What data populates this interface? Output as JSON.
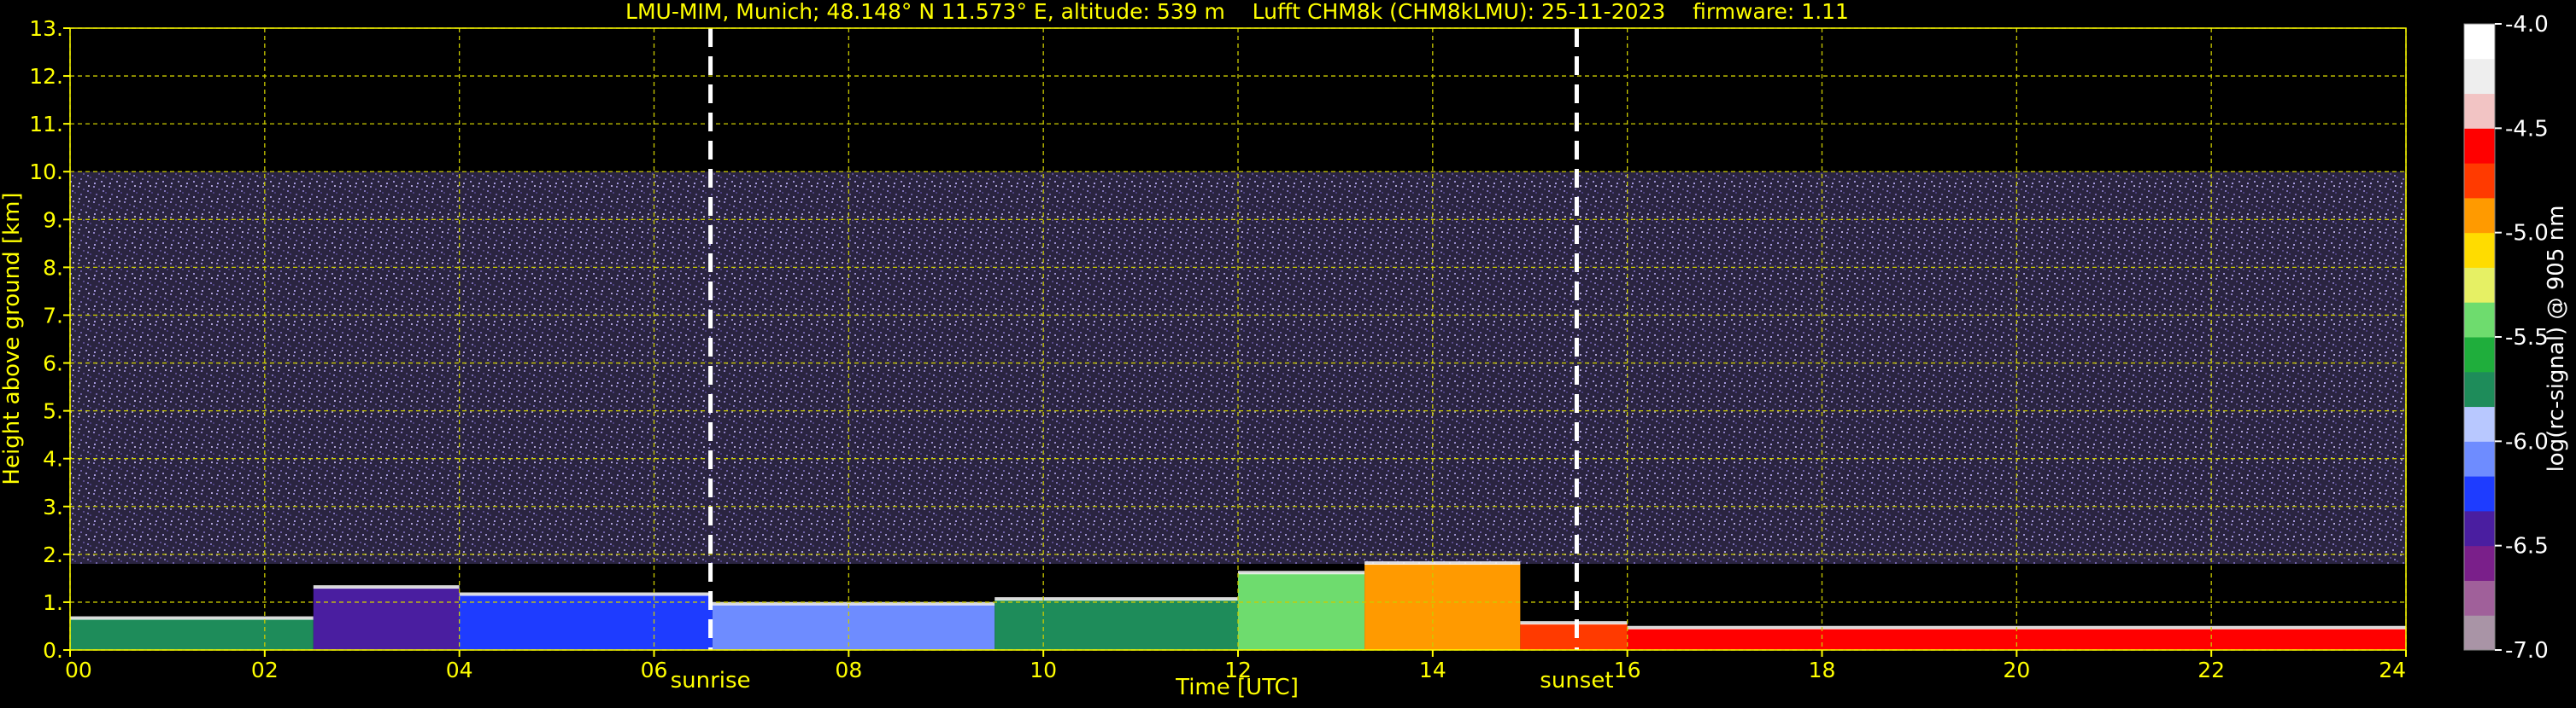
{
  "chart_data": {
    "type": "heatmap",
    "title": "LMU-MIM, Munich; 48.148° N 11.573° E, altitude: 539 m    Lufft CHM8k (CHM8kLMU): 25-11-2023    firmware: 1.11",
    "xlabel": "Time [UTC]",
    "ylabel": "Height above ground [km]",
    "xlim": [
      0,
      24
    ],
    "ylim": [
      0,
      13
    ],
    "x_ticks": [
      0,
      2,
      4,
      6,
      8,
      10,
      12,
      14,
      16,
      18,
      20,
      22,
      24
    ],
    "x_tick_labels": [
      "00",
      "02",
      "04",
      "06",
      "08",
      "10",
      "12",
      "14",
      "16",
      "18",
      "20",
      "22",
      "24"
    ],
    "y_ticks": [
      0,
      1,
      2,
      3,
      4,
      5,
      6,
      7,
      8,
      9,
      10,
      11,
      12,
      13
    ],
    "y_tick_labels": [
      "0.",
      "1.",
      "2.",
      "3.",
      "4.",
      "5.",
      "6.",
      "7.",
      "8.",
      "9.",
      "10.",
      "11.",
      "12.",
      "13."
    ],
    "grid": true,
    "data_top_km": 10.0,
    "events": [
      {
        "label": "sunrise",
        "time_h": 6.58
      },
      {
        "label": "sunset",
        "time_h": 15.48
      }
    ],
    "colorbar": {
      "label": "log(rc-signal) @ 905 nm",
      "range": [
        -7.0,
        -4.0
      ],
      "ticks": [
        -4.0,
        -4.5,
        -5.0,
        -5.5,
        -6.0,
        -6.5,
        -7.0
      ],
      "tick_labels": [
        "-4.0",
        "-4.5",
        "-5.0",
        "-5.5",
        "-6.0",
        "-6.5",
        "-7.0"
      ]
    },
    "layers": [
      {
        "t0": 0.0,
        "t1": 2.5,
        "h_top": 0.65,
        "level": -5.8
      },
      {
        "t0": 2.5,
        "t1": 4.0,
        "h_top": 1.3,
        "level": -6.5
      },
      {
        "t0": 4.0,
        "t1": 6.6,
        "h_top": 1.15,
        "level": -6.25
      },
      {
        "t0": 6.6,
        "t1": 9.5,
        "h_top": 0.95,
        "level": -6.1
      },
      {
        "t0": 9.5,
        "t1": 12.0,
        "h_top": 1.05,
        "level": -5.75
      },
      {
        "t0": 12.0,
        "t1": 13.3,
        "h_top": 1.6,
        "level": -5.35
      },
      {
        "t0": 13.3,
        "t1": 14.9,
        "h_top": 1.8,
        "level": -5.0
      },
      {
        "t0": 14.9,
        "t1": 16.0,
        "h_top": 0.55,
        "level": -4.8
      },
      {
        "t0": 16.0,
        "t1": 24.0,
        "h_top": 0.45,
        "level": -4.6
      }
    ]
  },
  "colors": {
    "background": "#000000",
    "text": "#ffff00",
    "grid": "#cccc00",
    "event_line": "#ffffff",
    "noise": "#6a5a9a",
    "colormap": [
      "#a994a6",
      "#a0609a",
      "#7a1f8a",
      "#4a1ea0",
      "#1e3cff",
      "#6e8cff",
      "#b8c8ff",
      "#1e8c5a",
      "#1fae3c",
      "#6edc6e",
      "#e6f064",
      "#ffdc00",
      "#ff9a00",
      "#ff3a00",
      "#ff0000",
      "#f2c4c4",
      "#eeeeee",
      "#ffffff"
    ]
  }
}
